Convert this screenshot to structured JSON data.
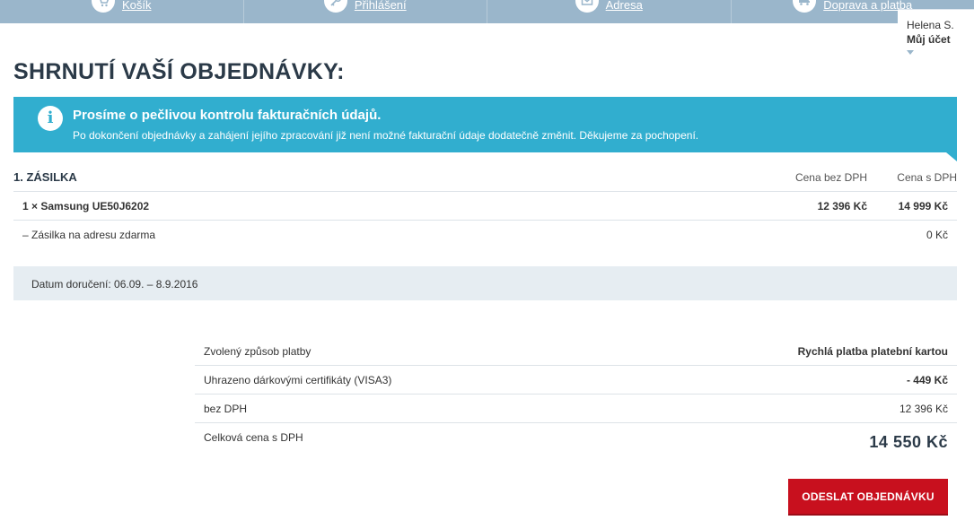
{
  "nav": {
    "steps": [
      {
        "label": "Košík",
        "icon": "cart-icon"
      },
      {
        "label": "Přihlášení",
        "icon": "key-icon"
      },
      {
        "label": "Adresa",
        "icon": "envelope-icon"
      },
      {
        "label": "Doprava a platba",
        "icon": "truck-icon"
      }
    ]
  },
  "account": {
    "user_name": "Helena S.",
    "label": "Můj účet"
  },
  "page_title": "SHRNUTÍ VAŠÍ OBJEDNÁVKY:",
  "info": {
    "title": "Prosíme o pečlivou kontrolu fakturačních údajů.",
    "text": "Po dokončení objednávky a zahájení jejího zpracování již není možné fakturační údaje dodatečně změnit. Děkujeme za pochopení."
  },
  "shipment": {
    "title": "1. ZÁSILKA",
    "col_net": "Cena bez DPH",
    "col_gross": "Cena s DPH",
    "item": {
      "name": "1 × Samsung UE50J6202",
      "net": "12 396 Kč",
      "gross": "14 999 Kč"
    },
    "delivery": {
      "name": "– Zásilka na adresu zdarma",
      "price": "0 Kč"
    },
    "delivery_date": "Datum doručení: 06.09. – 8.9.2016"
  },
  "summary": {
    "payment_label": "Zvolený způsob platby",
    "payment_value": "Rychlá platba platební kartou",
    "voucher_label": "Uhrazeno dárkovými certifikáty (VISA3)",
    "voucher_value": "- 449 Kč",
    "net_label": "bez DPH",
    "net_value": "12 396 Kč",
    "total_label": "Celková cena s DPH",
    "total_value": "14 550 Kč"
  },
  "submit_label": "ODESLAT OBJEDNÁVKU",
  "colors": {
    "nav": "#9ab6cb",
    "info": "#31aecf",
    "submit": "#c8101e",
    "date_box": "#e6edf2"
  }
}
